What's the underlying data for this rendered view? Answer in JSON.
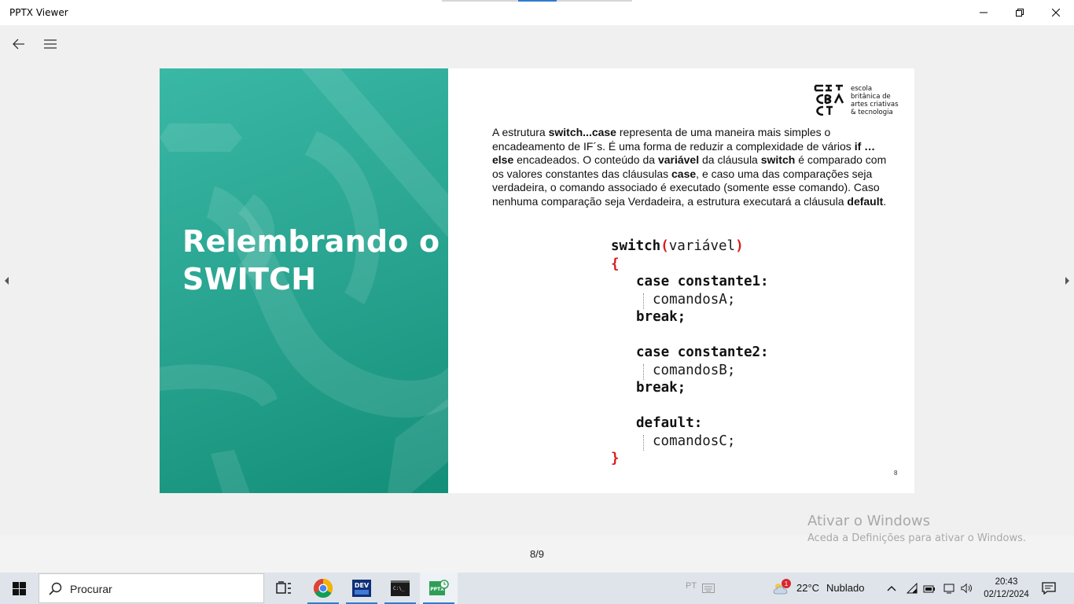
{
  "window": {
    "title": "PPTX Viewer"
  },
  "slide": {
    "title_line1": "Relembrando o",
    "title_line2": "SWITCH",
    "logo_text": [
      "escola",
      "britânica de",
      "artes criativas",
      "& tecnologia"
    ],
    "paragraph": {
      "p1": "A estrutura ",
      "b1": "switch...case",
      "p2": " representa de uma maneira mais simples o encadeamento de IF´s. É uma forma de reduzir a complexidade de vários ",
      "b2": "if … else",
      "p3": " encadeados. O conteúdo da ",
      "b3": "variável",
      "p4": " da cláusula ",
      "b4": "switch",
      "p5": " é comparado com os valores constantes das cláusulas ",
      "b5": "case",
      "p6": ", e caso uma das comparações seja verdadeira, o comando associado é executado (somente esse comando). Caso nenhuma comparação seja Verdadeira, a estrutura executará a cláusula ",
      "b6": "default",
      "p7": "."
    },
    "code": {
      "l1_kw": "switch",
      "l1_rest": " (variável)",
      "open_brace": "{",
      "case1": "case",
      "case1_rest": " constante1:",
      "cmdA": "comandosA;",
      "break1": "break;",
      "case2": "case",
      "case2_rest": " constante2:",
      "cmdB": "comandosB;",
      "break2": "break;",
      "default": "default:",
      "cmdC": "comandosC;",
      "close_brace": "}"
    },
    "number": "8"
  },
  "pager": {
    "indicator": "8/9"
  },
  "watermark": {
    "line1": "Ativar o Windows",
    "line2": "Aceda a Definições para ativar o Windows."
  },
  "taskbar": {
    "search_placeholder": "Procurar",
    "lang": "PT",
    "weather_badge": "1",
    "weather_temp": "22°C",
    "weather_desc": "Nublado",
    "time": "20:43",
    "date": "02/12/2024"
  }
}
